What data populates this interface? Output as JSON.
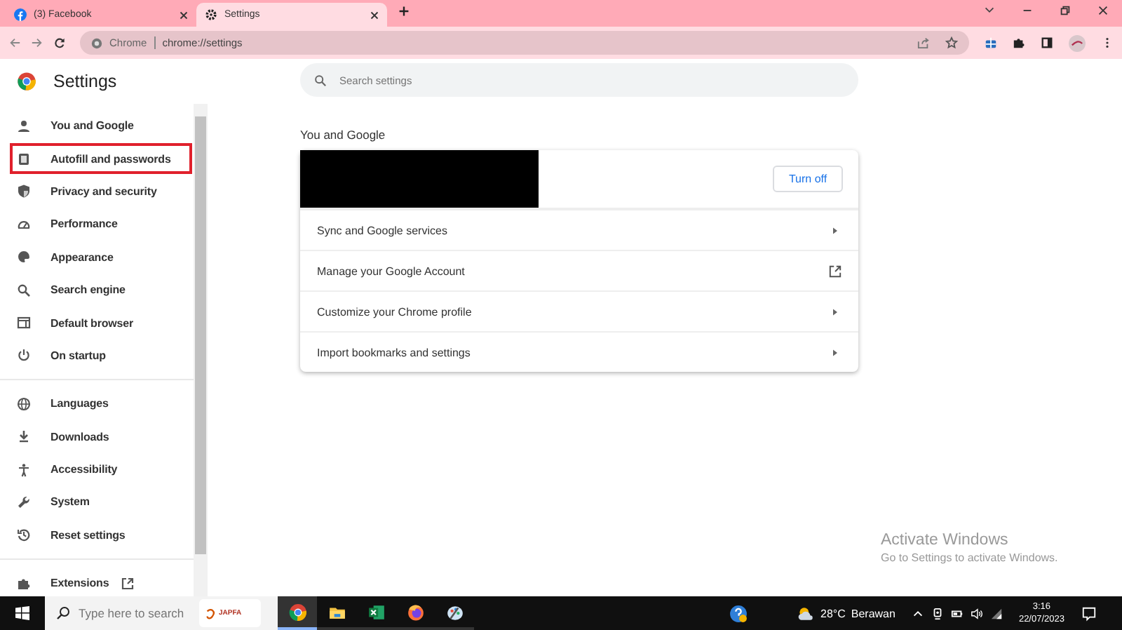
{
  "tabs": [
    {
      "label": "(3) Facebook",
      "selected": false
    },
    {
      "label": "Settings",
      "selected": true
    }
  ],
  "address_bar": {
    "origin": "Chrome",
    "url": "chrome://settings"
  },
  "sidebar": {
    "title": "Settings",
    "groups": [
      [
        {
          "label": "You and Google",
          "highlighted": false
        },
        {
          "label": "Autofill and passwords",
          "highlighted": true
        },
        {
          "label": "Privacy and security",
          "highlighted": false
        },
        {
          "label": "Performance",
          "highlighted": false
        },
        {
          "label": "Appearance",
          "highlighted": false
        },
        {
          "label": "Search engine",
          "highlighted": false
        },
        {
          "label": "Default browser",
          "highlighted": false
        },
        {
          "label": "On startup",
          "highlighted": false
        }
      ],
      [
        {
          "label": "Languages",
          "highlighted": false
        },
        {
          "label": "Downloads",
          "highlighted": false
        },
        {
          "label": "Accessibility",
          "highlighted": false
        },
        {
          "label": "System",
          "highlighted": false
        },
        {
          "label": "Reset settings",
          "highlighted": false
        }
      ],
      [
        {
          "label": "Extensions",
          "highlighted": false,
          "external": true
        }
      ]
    ]
  },
  "search": {
    "placeholder": "Search settings"
  },
  "section": {
    "title": "You and Google",
    "account_redacted": true,
    "button": "Turn off",
    "rows": [
      {
        "label": "Sync and Google services",
        "kind": "arrow"
      },
      {
        "label": "Manage your Google Account",
        "kind": "external"
      },
      {
        "label": "Customize your Chrome profile",
        "kind": "arrow"
      },
      {
        "label": "Import bookmarks and settings",
        "kind": "arrow"
      }
    ]
  },
  "watermark": {
    "title": "Activate Windows",
    "subtitle": "Go to Settings to activate Windows."
  },
  "taskbar": {
    "search_placeholder": "Type here to search",
    "logo_text": "JAPFA",
    "apps": [
      {
        "selected": true
      },
      {
        "selected": false
      },
      {
        "selected": false
      },
      {
        "selected": false
      },
      {
        "selected": false
      }
    ],
    "temperature": "28°C",
    "weather": "Berawan",
    "time": "3:16",
    "date": "22/07/2023"
  }
}
